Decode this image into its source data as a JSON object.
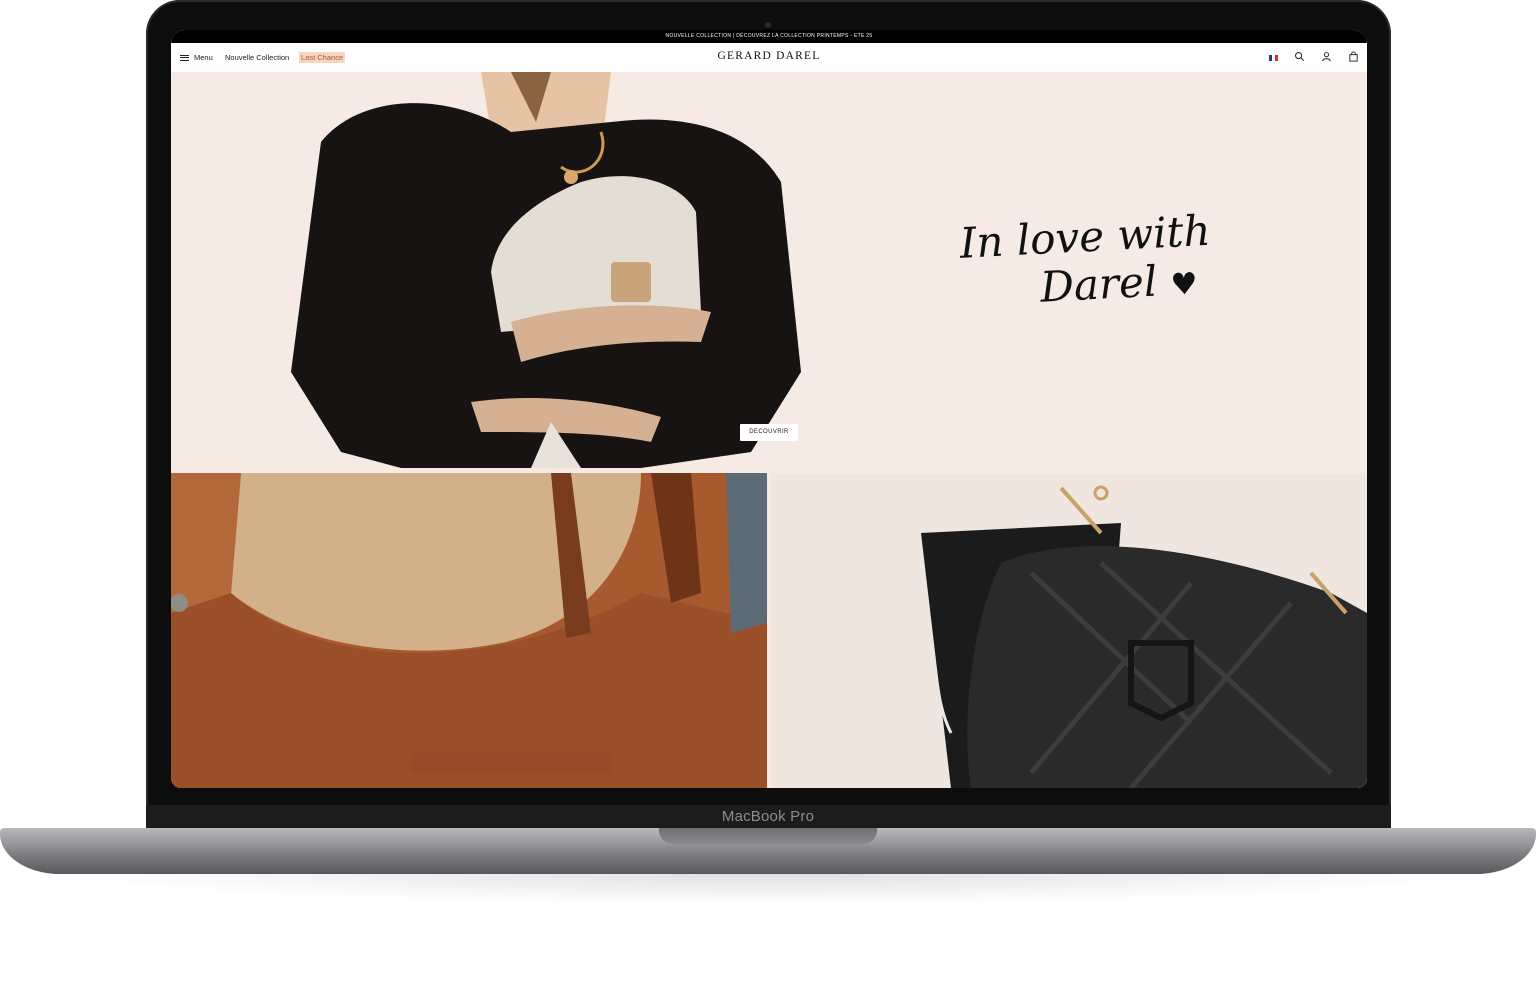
{
  "device": {
    "label": "MacBook Pro"
  },
  "site": {
    "announcement": "NOUVELLE COLLECTION | DÉCOUVREZ LA COLLECTION PRINTEMPS - ETE 25",
    "brand": "GERARD DAREL",
    "nav": {
      "menu": "Menu",
      "new_collection": "Nouvelle Collection",
      "last_chance": "Last Chance"
    },
    "icons": [
      "flag-icon",
      "search-icon",
      "account-icon",
      "bag-icon"
    ]
  },
  "hero": {
    "script_line1": "In love with",
    "script_line2": "Darel",
    "heart": "♥",
    "cta": "DECOUVRIR"
  },
  "colors": {
    "accent": "#b4542e",
    "accent_bg": "#f4d6c3",
    "hero_bg": "#f5ebe4"
  }
}
